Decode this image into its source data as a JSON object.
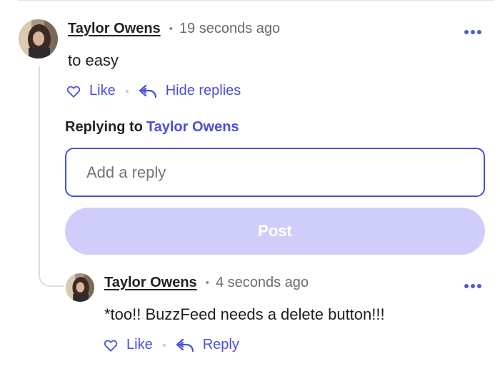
{
  "comment": {
    "author": "Taylor Owens",
    "separator": "•",
    "time": "19 seconds ago",
    "body": "to easy",
    "like_label": "Like",
    "hide_replies_label": "Hide replies"
  },
  "reply_form": {
    "replying_prefix": "Replying to",
    "replying_to": "Taylor Owens",
    "placeholder": "Add a reply",
    "post_label": "Post"
  },
  "reply": {
    "author": "Taylor Owens",
    "separator": "•",
    "time": "4 seconds ago",
    "body": "*too!! BuzzFeed needs a delete button!!!",
    "like_label": "Like",
    "reply_label": "Reply"
  },
  "icons": {
    "like": "heart-icon",
    "hide_replies": "reply-arrow-icon",
    "reply": "reply-arrow-icon",
    "more": "more-dots-icon"
  },
  "colors": {
    "accent": "#4a4ede",
    "post_button_disabled": "#cfcdfa",
    "thread_line": "#dcdcdc",
    "text": "#222222",
    "muted": "#6b6b6b"
  }
}
